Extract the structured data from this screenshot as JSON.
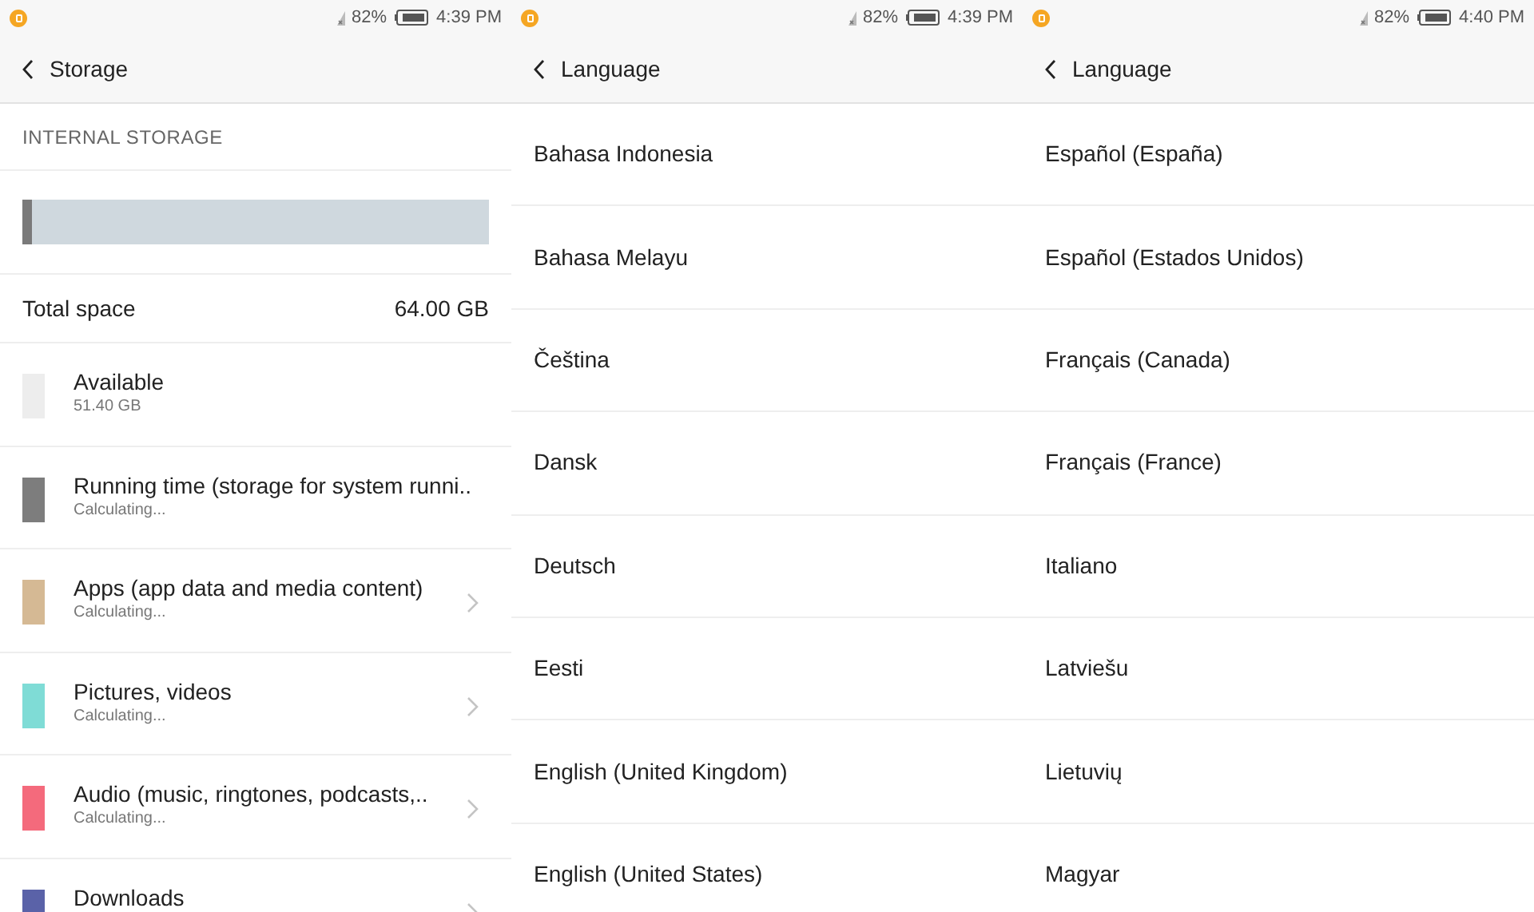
{
  "screens": [
    {
      "status_bar": {
        "battery": "82%",
        "time": "4:39 PM"
      },
      "header": {
        "title": "Storage"
      },
      "kind": "storage",
      "section_title": "INTERNAL STORAGE",
      "storage_bar": {
        "level": 0.02
      },
      "total": {
        "label": "Total space",
        "value": "64.00 GB"
      },
      "items": [
        {
          "name": "Available",
          "detail": "51.40 GB",
          "color": "#ededed",
          "chevron": false
        },
        {
          "name": "Running time (storage for system runni..",
          "detail": "Calculating...",
          "color": "#7d7d7d",
          "chevron": false
        },
        {
          "name": "Apps (app data and media content)",
          "detail": "Calculating...",
          "color": "#d5b994",
          "chevron": true
        },
        {
          "name": "Pictures, videos",
          "detail": "Calculating...",
          "color": "#7fdcd6",
          "chevron": true
        },
        {
          "name": "Audio (music, ringtones, podcasts,..",
          "detail": "Calculating...",
          "color": "#f46a7c",
          "chevron": true
        },
        {
          "name": "Downloads",
          "color": "#5a62a8",
          "chevron": true
        }
      ]
    },
    {
      "status_bar": {
        "battery": "82%",
        "time": "4:39 PM"
      },
      "header": {
        "title": "Language"
      },
      "kind": "list",
      "items": [
        "Bahasa Indonesia",
        "Bahasa Melayu",
        "Čeština",
        "Dansk",
        "Deutsch",
        "Eesti",
        "English (United Kingdom)",
        "English (United States)"
      ]
    },
    {
      "status_bar": {
        "battery": "82%",
        "time": "4:40 PM"
      },
      "header": {
        "title": "Language"
      },
      "kind": "list",
      "items": [
        "Español (España)",
        "Español (Estados Unidos)",
        "Français (Canada)",
        "Français (France)",
        "Italiano",
        "Latviešu",
        "Lietuvių",
        "Magyar"
      ]
    }
  ]
}
